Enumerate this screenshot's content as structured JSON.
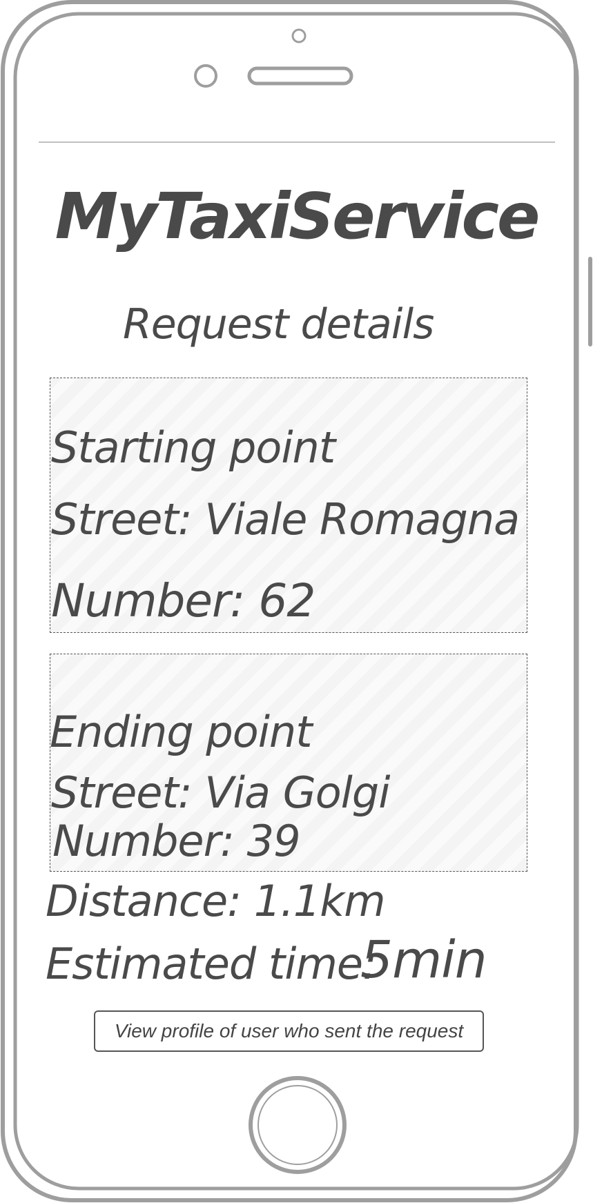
{
  "app": {
    "title": "MyTaxiService",
    "screen_title": "Request details"
  },
  "starting_point": {
    "heading": "Starting point",
    "street": "Street: Viale Romagna",
    "number": "Number: 62"
  },
  "ending_point": {
    "heading": "Ending point",
    "street": "Street: Via Golgi",
    "number": "Number: 39"
  },
  "trip": {
    "distance": "Distance: 1.1km",
    "estimated_time_label": "Estimated time:",
    "estimated_time_value": "5min"
  },
  "actions": {
    "view_profile_label": "View profile of user who sent the request"
  },
  "device": {
    "type": "smartphone-wireframe",
    "frame_color": "#9e9e9e"
  }
}
